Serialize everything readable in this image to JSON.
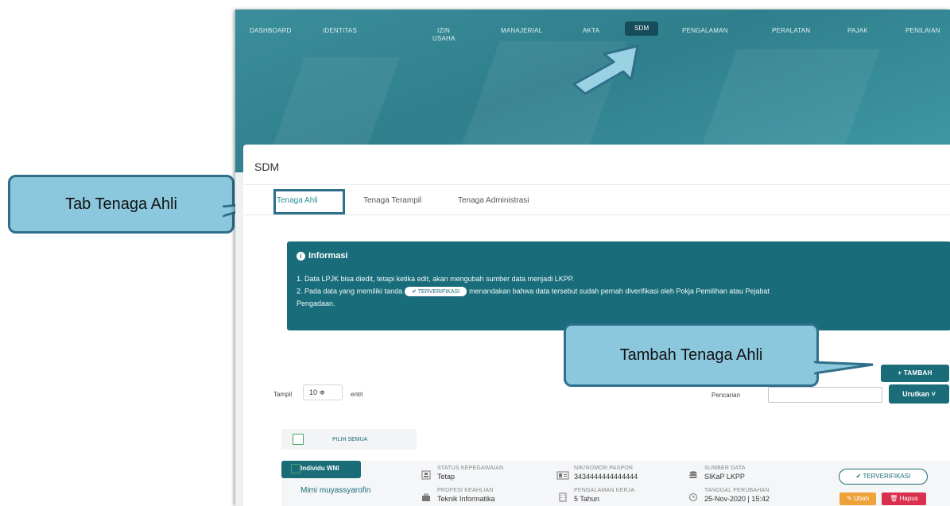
{
  "nav": {
    "items": [
      "DASHBOARD",
      "IDENTITAS",
      "IZIN USAHA",
      "MANAJERIAL",
      "AKTA",
      "SDM",
      "PENGALAMAN",
      "PERALATAN",
      "PAJAK",
      "PENILAIAN"
    ],
    "active": "SDM"
  },
  "card": {
    "title": "SDM"
  },
  "tabs": [
    "Tenaga Ahli",
    "Tenaga Terampil",
    "Tenaga Administrasi"
  ],
  "info": {
    "title": "Informasi",
    "line1": "1. Data LPJK bisa diedit, tetapi ketika edit, akan mengubah sumber data menjadi LKPP.",
    "line2_a": "2. Pada data yang memiliki tanda",
    "line2_badge": "✔ TERVERIFIKASI",
    "line2_b": "menandakan bahwa data tersebut sudah pernah diverifikasi oleh Pokja Pemilihan atau Pejabat",
    "line3": "Pengadaan."
  },
  "toolbar": {
    "tambah_label": "+ TAMBAH",
    "tampil_label": "Tampil",
    "tampil_value": "10 ≑",
    "entri_label": "entri",
    "pencarian_label": "Pencarian",
    "search_value": "",
    "urutkan_label": "Urutkan ˅"
  },
  "select_all": {
    "label": "PILIH SEMUA"
  },
  "row": {
    "type_badge": "Individu WNI",
    "name": "Mimi muyassyarofin",
    "status_label": "STATUS KEPEGAWAIAN",
    "status_value": "Tetap",
    "profesi_label": "PROFESI KEAHLIAN",
    "profesi_value": "Teknik Informatika",
    "nik_label": "NIK/NOMOR PASPOR",
    "nik_value": "3434444444444444",
    "pengalaman_label": "PENGALAMAN KERJA",
    "pengalaman_value": "5 Tahun",
    "sumber_label": "SUMBER DATA",
    "sumber_value": "SIKaP LKPP",
    "tanggal_label": "TANGGAL PERUBAHAN",
    "tanggal_value": "25-Nov-2020 | 15:42",
    "verified_label": "✔ TERVERIFIKASI",
    "ubah_label": "✎ Ubah",
    "hapus_label": "🗑 Hapus"
  },
  "callouts": {
    "tab": "Tab Tenaga Ahli",
    "tambah": "Tambah Tenaga Ahli"
  },
  "colors": {
    "teal": "#1b6c79",
    "callout_fill": "#8bc8de",
    "callout_border": "#2e6f8a",
    "ubah": "#f0a23a",
    "hapus": "#d9304e"
  }
}
